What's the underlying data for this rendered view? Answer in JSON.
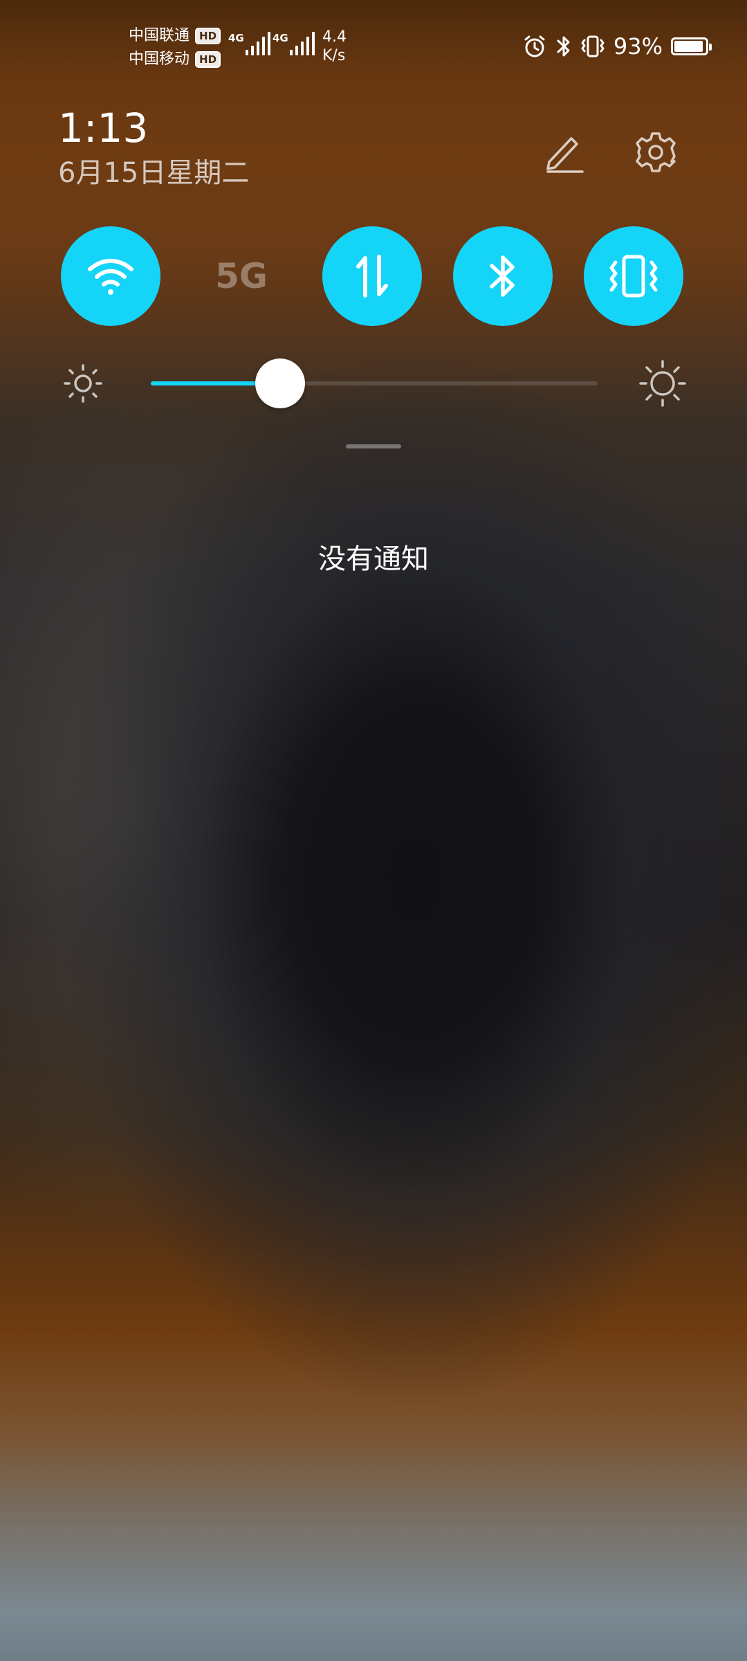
{
  "status_bar": {
    "carrier1": "中国联通",
    "carrier2": "中国移动",
    "hd_badge": "HD",
    "net1": "4G",
    "net2": "4G",
    "speed_value": "4.4",
    "speed_unit": "K/s",
    "battery_percent": "93%",
    "battery_level": 0.93,
    "icons": [
      "alarm-icon",
      "bluetooth-icon",
      "vibrate-icon",
      "battery-icon"
    ]
  },
  "header": {
    "time": "1:13",
    "date": "6月15日星期二",
    "edit_icon": "pencil-icon",
    "settings_icon": "gear-icon"
  },
  "toggles": [
    {
      "name": "wifi",
      "icon": "wifi-icon",
      "active": true
    },
    {
      "name": "5g",
      "label": "5G",
      "active": false
    },
    {
      "name": "mobile-data",
      "icon": "data-arrows-icon",
      "active": true
    },
    {
      "name": "bluetooth",
      "icon": "bluetooth-icon",
      "active": true
    },
    {
      "name": "vibrate",
      "icon": "vibrate-icon",
      "active": true
    }
  ],
  "brightness": {
    "level": 0.29,
    "low_icon": "brightness-low-icon",
    "high_icon": "brightness-high-icon"
  },
  "notifications": {
    "empty_text": "没有通知"
  },
  "colors": {
    "accent": "#14d4f8"
  }
}
